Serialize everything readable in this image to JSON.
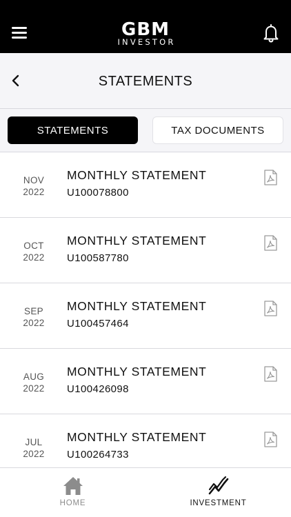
{
  "app": {
    "logo_main": "GBM",
    "logo_sub": "INVESTOR",
    "icons": {
      "menu": "hamburger-menu-icon",
      "bell": "bell-icon"
    }
  },
  "header": {
    "title": "STATEMENTS",
    "back_icon": "chevron-left-icon"
  },
  "tabs": [
    {
      "label": "STATEMENTS",
      "active": true
    },
    {
      "label": "TAX DOCUMENTS",
      "active": false
    }
  ],
  "statements": [
    {
      "month": "NOV",
      "year": "2022",
      "title": "MONTHLY STATEMENT",
      "account": "U100078800",
      "icon": "pdf-file-icon"
    },
    {
      "month": "OCT",
      "year": "2022",
      "title": "MONTHLY STATEMENT",
      "account": "U100587780",
      "icon": "pdf-file-icon"
    },
    {
      "month": "SEP",
      "year": "2022",
      "title": "MONTHLY STATEMENT",
      "account": "U100457464",
      "icon": "pdf-file-icon"
    },
    {
      "month": "AUG",
      "year": "2022",
      "title": "MONTHLY STATEMENT",
      "account": "U100426098",
      "icon": "pdf-file-icon"
    },
    {
      "month": "JUL",
      "year": "2022",
      "title": "MONTHLY STATEMENT",
      "account": "U100264733",
      "icon": "pdf-file-icon"
    }
  ],
  "bottom_nav": [
    {
      "label": "HOME",
      "icon": "home-icon",
      "active": false
    },
    {
      "label": "INVESTMENT",
      "icon": "investment-chart-icon",
      "active": true
    }
  ],
  "colors": {
    "topbar": "#000000",
    "header_bg": "#f5f5f8",
    "tab_active_bg": "#000000",
    "inactive_nav": "#8c8c8c",
    "icon_gray": "#9a9a9a"
  }
}
